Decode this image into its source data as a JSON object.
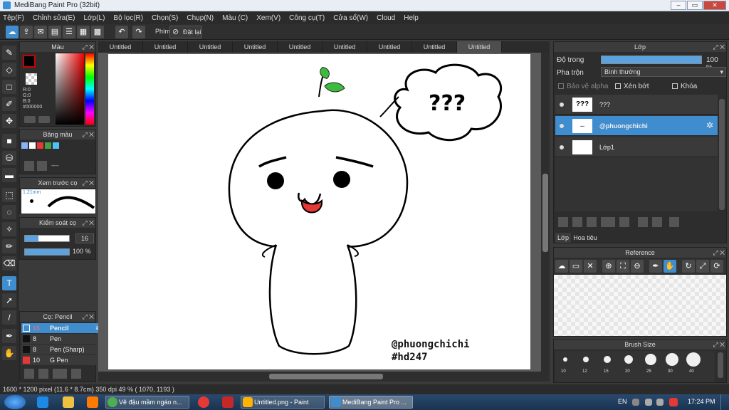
{
  "window": {
    "title": "MediBang Paint Pro (32bit)"
  },
  "menu": [
    "Tệp(F)",
    "Chỉnh sửa(E)",
    "Lớp(L)",
    "Bộ lọc(R)",
    "Chọn(S)",
    "Chụp(N)",
    "Màu (C)",
    "Xem(V)",
    "Công cụ(T)",
    "Cửa sổ(W)",
    "Cloud",
    "Help"
  ],
  "toolbar": {
    "phim_label": "Phím",
    "reset_label": "Đặt lại"
  },
  "tabs": [
    "Untitled",
    "Untitled",
    "Untitled",
    "Untitled",
    "Untitled",
    "Untitled",
    "Untitled",
    "Untitled",
    "Untitled"
  ],
  "color_panel": {
    "title": "Màu",
    "r": "R:0",
    "g": "G:0",
    "b": "B:0",
    "hex": "#000000"
  },
  "palette_panel": {
    "title": "Bảng màu",
    "colors": [
      "#8ab4f8",
      "#ffffff",
      "#e53935",
      "#43a047",
      "#4fc3f7"
    ],
    "extra": "----"
  },
  "brush_preview": {
    "title": "Xem trước cọ",
    "size": "1.21mm"
  },
  "brush_control": {
    "title": "Kiểm soát cọ",
    "size": "16",
    "opacity": "100 %"
  },
  "brush_list": {
    "title": "Cọ: Pencil",
    "items": [
      {
        "size": "16",
        "name": "Pencil",
        "color": "#3f8dcf"
      },
      {
        "size": "8",
        "name": "Pen",
        "color": "#111111"
      },
      {
        "size": "8",
        "name": "Pen (Sharp)",
        "color": "#111111"
      },
      {
        "size": "10",
        "name": "G Pen",
        "color": "#e53935"
      }
    ]
  },
  "layer_panel": {
    "title": "Lớp",
    "opacity_label": "Độ trong",
    "opacity_value": "100 %",
    "blend_label": "Pha trộn",
    "blend_value": "Bình thường",
    "alpha_label": "Bảo vệ alpha",
    "clip_label": "Xén bớt",
    "lock_label": "Khóa",
    "layers": [
      {
        "name": "???",
        "thumb": "???"
      },
      {
        "name": "@phuongchichi",
        "thumb": "..."
      },
      {
        "name": "Lớp1",
        "thumb": ""
      }
    ],
    "tab_layer": "Lớp",
    "tab_navigator": "Hoa tiêu"
  },
  "reference_panel": {
    "title": "Reference"
  },
  "brush_size_panel": {
    "title": "Brush Size",
    "sizes": [
      "10",
      "12",
      "15",
      "20",
      "25",
      "30",
      "40"
    ]
  },
  "canvas_text": {
    "bubble": "???",
    "signature1": "@phuongchichi",
    "signature2": "#hd247"
  },
  "status": "1600 * 1200 pixel  (11.6 * 8.7cm)  350 dpi  49 %  ( 1070, 1193 )",
  "taskbar": {
    "items": [
      "Vẽ đậu mầm ngáo n...",
      "Untitled.png - Paint",
      "MediBang Paint Pro ..."
    ],
    "lang": "EN",
    "time": "17:24 PM"
  }
}
